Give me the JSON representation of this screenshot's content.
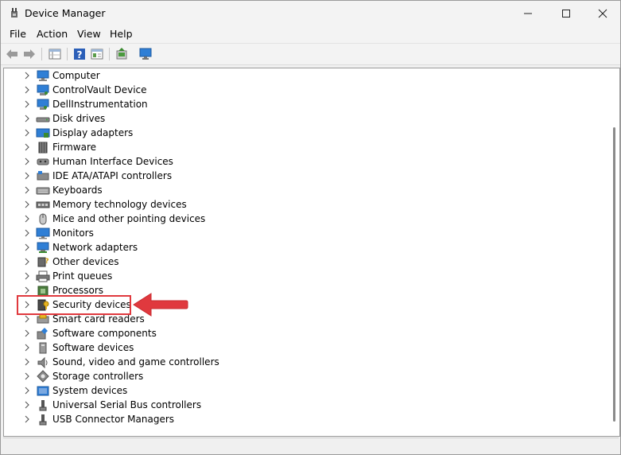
{
  "window": {
    "title": "Device Manager",
    "controls": [
      "minimize",
      "maximize",
      "close"
    ]
  },
  "menu": {
    "items": [
      {
        "label": "File"
      },
      {
        "label": "Action"
      },
      {
        "label": "View"
      },
      {
        "label": "Help"
      }
    ]
  },
  "toolbar": {
    "buttons": [
      "back-icon",
      "forward-icon",
      "properties-grid-icon",
      "help-icon",
      "console-tree-icon",
      "update-driver-icon",
      "monitor-scan-icon"
    ]
  },
  "tree": {
    "items": [
      {
        "label": "Computer",
        "icon": "computer-icon"
      },
      {
        "label": "ControlVault Device",
        "icon": "controlvault-icon"
      },
      {
        "label": "DellInstrumentation",
        "icon": "dell-instrumentation-icon"
      },
      {
        "label": "Disk drives",
        "icon": "disk-drive-icon"
      },
      {
        "label": "Display adapters",
        "icon": "display-adapter-icon"
      },
      {
        "label": "Firmware",
        "icon": "firmware-icon"
      },
      {
        "label": "Human Interface Devices",
        "icon": "hid-icon"
      },
      {
        "label": "IDE ATA/ATAPI controllers",
        "icon": "ide-controller-icon"
      },
      {
        "label": "Keyboards",
        "icon": "keyboard-icon"
      },
      {
        "label": "Memory technology devices",
        "icon": "memory-icon"
      },
      {
        "label": "Mice and other pointing devices",
        "icon": "mouse-icon"
      },
      {
        "label": "Monitors",
        "icon": "monitor-icon"
      },
      {
        "label": "Network adapters",
        "icon": "network-adapter-icon"
      },
      {
        "label": "Other devices",
        "icon": "other-devices-icon"
      },
      {
        "label": "Print queues",
        "icon": "printer-icon"
      },
      {
        "label": "Processors",
        "icon": "processor-icon"
      },
      {
        "label": "Security devices",
        "icon": "security-device-icon",
        "highlighted": true
      },
      {
        "label": "Smart card readers",
        "icon": "smart-card-reader-icon"
      },
      {
        "label": "Software components",
        "icon": "software-component-icon"
      },
      {
        "label": "Software devices",
        "icon": "software-device-icon"
      },
      {
        "label": "Sound, video and game controllers",
        "icon": "speaker-icon"
      },
      {
        "label": "Storage controllers",
        "icon": "storage-controller-icon"
      },
      {
        "label": "System devices",
        "icon": "system-device-icon"
      },
      {
        "label": "Universal Serial Bus controllers",
        "icon": "usb-icon"
      },
      {
        "label": "USB Connector Managers",
        "icon": "usb-connector-icon"
      }
    ]
  },
  "colors": {
    "highlight": "#e0393e",
    "icon_blue": "#2f7fd6",
    "help_blue": "#2b5fb8"
  }
}
